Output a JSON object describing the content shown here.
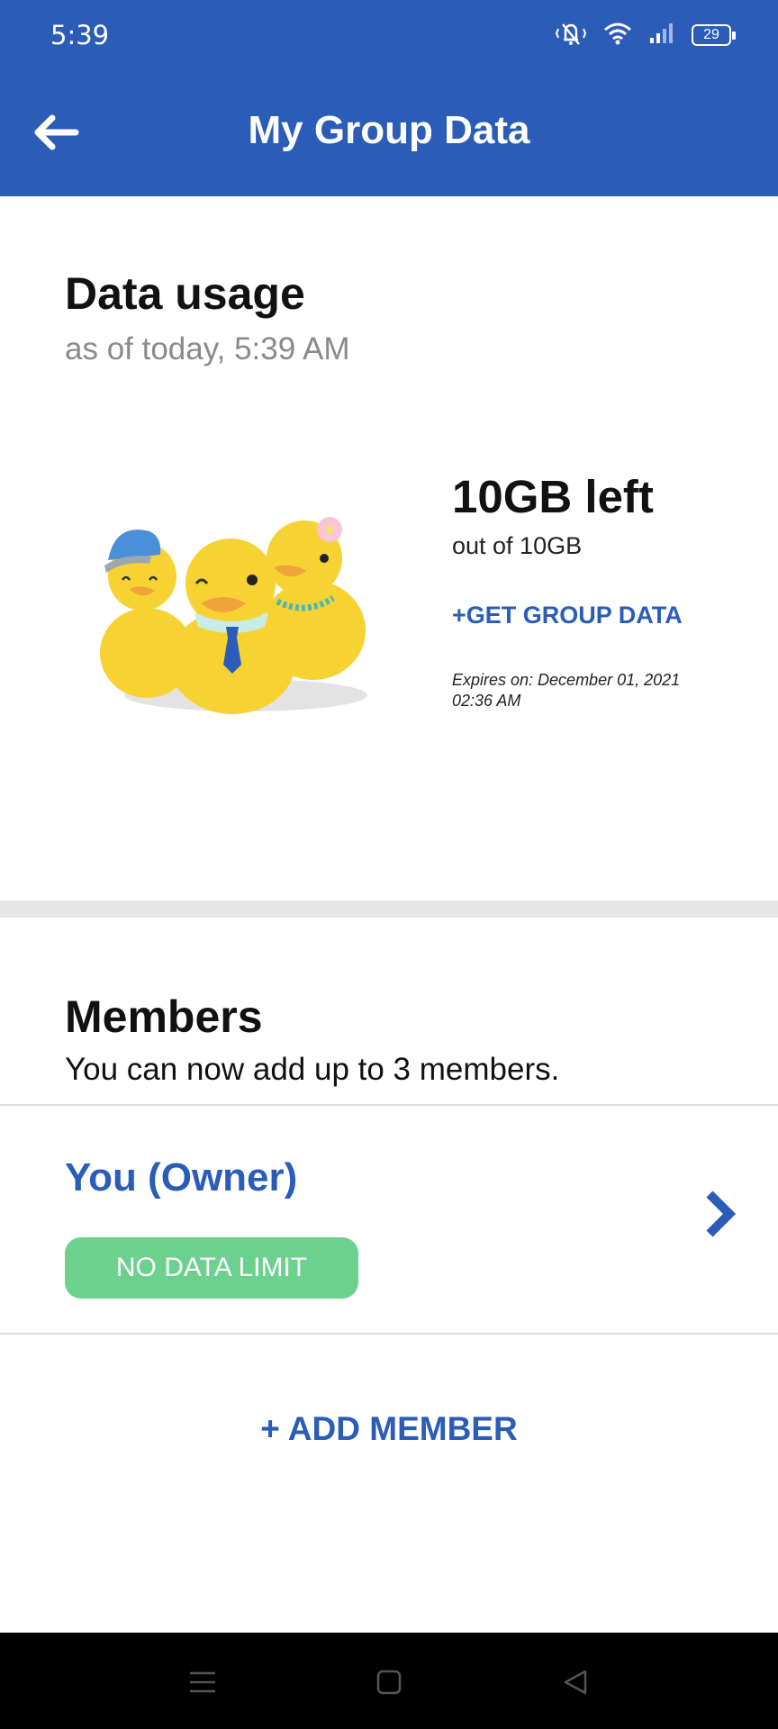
{
  "status_bar": {
    "time": "5:39",
    "battery": "29",
    "icons": [
      "vibrate-off-icon",
      "wifi-icon",
      "signal-icon",
      "battery-icon"
    ]
  },
  "app_bar": {
    "title": "My Group Data",
    "back_icon": "arrow-left-icon"
  },
  "data_usage": {
    "title": "Data usage",
    "subtitle": "as of today, 5:39 AM",
    "left": "10GB left",
    "out_of": "out of 10GB",
    "get_group_data": "+GET GROUP DATA",
    "expires": "Expires on: December 01, 2021 02:36 AM"
  },
  "members": {
    "title": "Members",
    "subtitle": "You can now add up to 3 members.",
    "owner": {
      "name": "You (Owner)",
      "badge": "NO DATA LIMIT"
    },
    "add_member": "+ ADD MEMBER"
  },
  "colors": {
    "brand": "#2a5cb8",
    "badge": "#6cd18e"
  },
  "nav_bar": {
    "icons": [
      "menu-icon",
      "home-icon",
      "back-icon"
    ]
  }
}
